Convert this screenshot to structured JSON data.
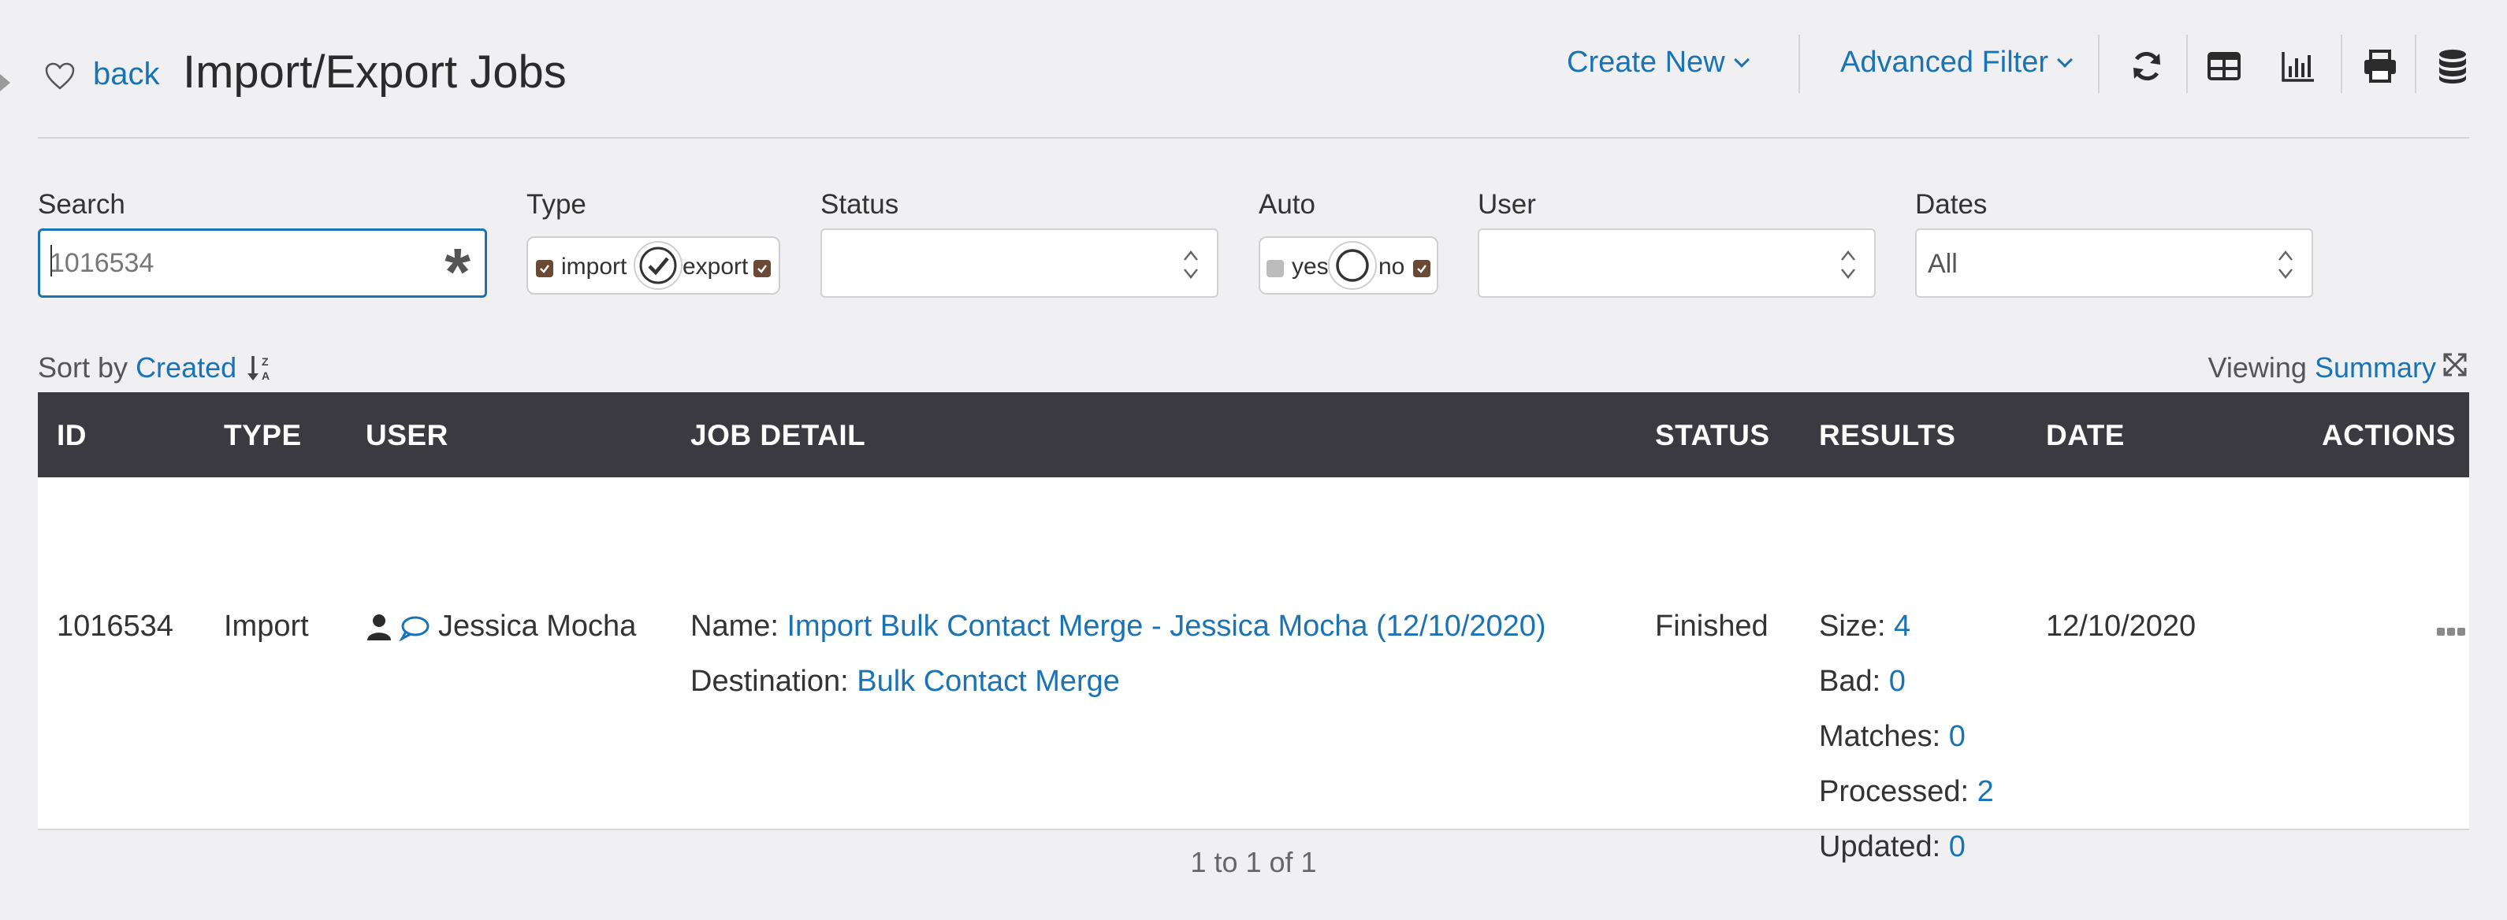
{
  "header": {
    "back_label": "back",
    "title": "Import/Export Jobs",
    "create_new": "Create New",
    "advanced_filter": "Advanced Filter"
  },
  "filters": {
    "search_label": "Search",
    "search_value": "1016534",
    "type_label": "Type",
    "type_import": "import",
    "type_export": "export",
    "status_label": "Status",
    "status_value": "",
    "auto_label": "Auto",
    "auto_yes": "yes",
    "auto_no": "no",
    "user_label": "User",
    "user_value": "",
    "dates_label": "Dates",
    "dates_value": "All"
  },
  "sort": {
    "prefix": "Sort by",
    "field": "Created"
  },
  "viewing": {
    "prefix": "Viewing",
    "mode": "Summary"
  },
  "table": {
    "columns": [
      "ID",
      "TYPE",
      "USER",
      "JOB DETAIL",
      "STATUS",
      "RESULTS",
      "DATE",
      "ACTIONS"
    ],
    "row": {
      "id": "1016534",
      "type": "Import",
      "user": "Jessica Mocha",
      "name_label": "Name:",
      "name_value": "Import Bulk Contact Merge - Jessica Mocha (12/10/2020)",
      "destination_label": "Destination:",
      "destination_value": "Bulk Contact Merge",
      "status": "Finished",
      "size_label": "Size:",
      "size_value": "4",
      "bad_label": "Bad:",
      "bad_value": "0",
      "matches_label": "Matches:",
      "matches_value": "0",
      "processed_label": "Processed:",
      "processed_value": "2",
      "updated_label": "Updated:",
      "updated_value": "0",
      "date": "12/10/2020"
    }
  },
  "pager": "1 to 1 of 1",
  "colors": {
    "accent": "#1a73b5",
    "header_bg": "#3a3a40",
    "checkbox": "#6b4a35",
    "page_bg": "#f0f0f2"
  }
}
